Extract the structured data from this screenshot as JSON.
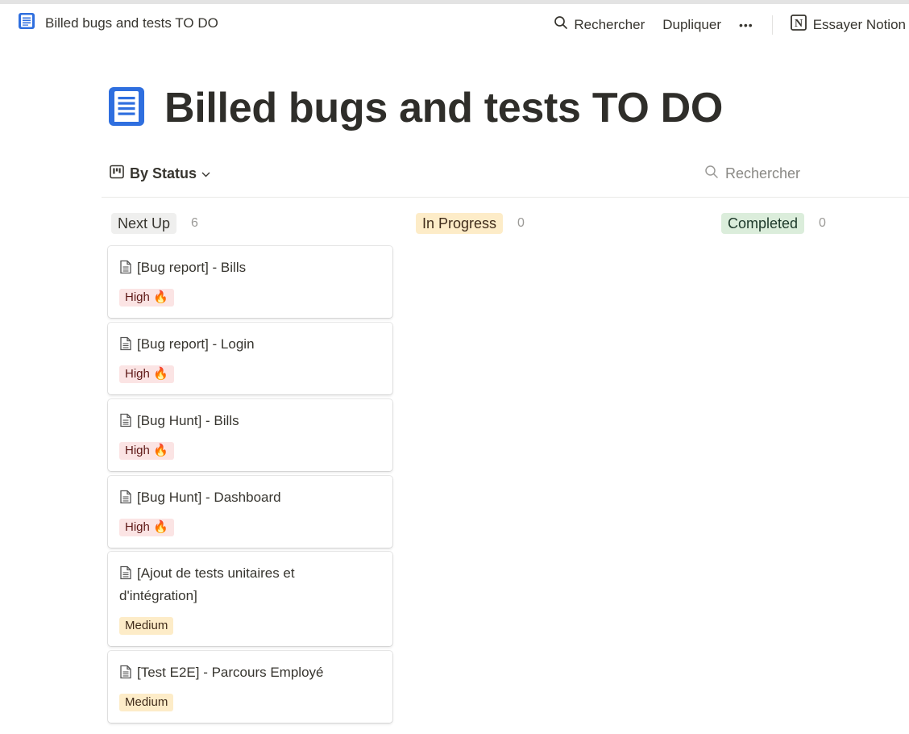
{
  "topbar": {
    "page_title": "Billed bugs and tests TO DO",
    "search_label": "Rechercher",
    "duplicate_label": "Dupliquer",
    "more_label": "•••",
    "try_notion_label": "Essayer Notion"
  },
  "page": {
    "title": "Billed bugs and tests TO DO",
    "icon": "notepad-icon",
    "accent_color": "#2f6fdf"
  },
  "view": {
    "name": "By Status",
    "search_placeholder": "Rechercher"
  },
  "columns": [
    {
      "label": "Next Up",
      "count": "6",
      "bg": "#efefee",
      "color": "#37352f"
    },
    {
      "label": "In Progress",
      "count": "0",
      "bg": "#fdecc8",
      "color": "#402c1b"
    },
    {
      "label": "Completed",
      "count": "0",
      "bg": "#dbeddb",
      "color": "#1c3829"
    }
  ],
  "cards": [
    {
      "title": "[Bug report] - Bills",
      "priority": "High 🔥",
      "level": "high"
    },
    {
      "title": "[Bug report] - Login",
      "priority": "High 🔥",
      "level": "high"
    },
    {
      "title": "[Bug Hunt] - Bills",
      "priority": "High 🔥",
      "level": "high"
    },
    {
      "title": "[Bug Hunt] - Dashboard",
      "priority": "High 🔥",
      "level": "high"
    },
    {
      "title": "[Ajout de tests unitaires et d'intégration]",
      "priority": "Medium",
      "level": "medium"
    },
    {
      "title": "[Test E2E] - Parcours Employé",
      "priority": "Medium",
      "level": "medium"
    }
  ]
}
